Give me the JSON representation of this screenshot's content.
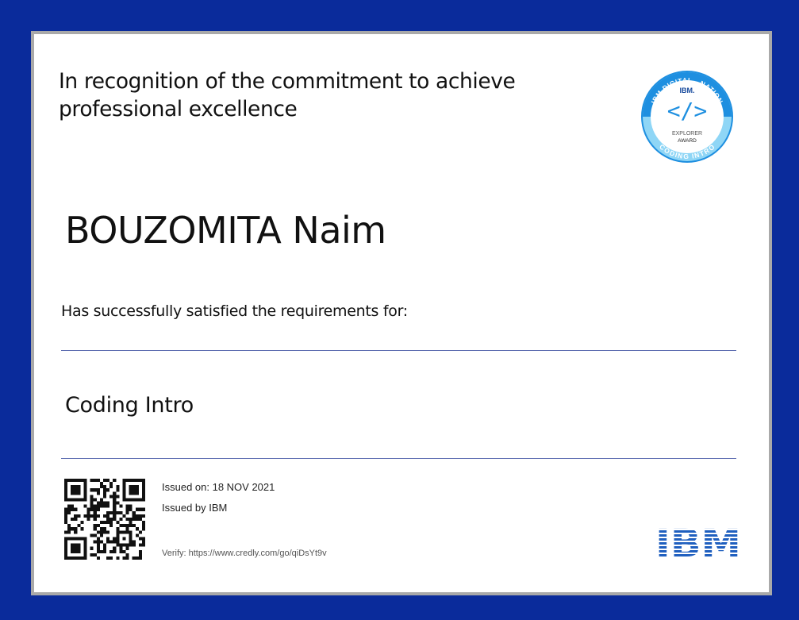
{
  "certificate": {
    "recognition_text": "In recognition of the commitment to achieve professional excellence",
    "recipient_name": "BOUZOMITA Naim",
    "requirements_text": "Has successfully satisfied the requirements for:",
    "course_title": "Coding Intro",
    "issued_on": "Issued on: 18 NOV 2021",
    "issued_by": "Issued by IBM",
    "verify_text": "Verify: https://www.credly.com/go/qiDsYt9v"
  },
  "badge": {
    "ring_top_text": "IBM DIGITAL - NATION",
    "ring_bottom_text": "CODING INTRO",
    "brand": "IBM.",
    "symbol": "</>",
    "line1": "EXPLORER",
    "line2": "AWARD",
    "colors": {
      "outer": "#1e8fe0",
      "inner_light": "#8fd6f6",
      "dark": "#174a9c"
    }
  },
  "logo": {
    "text": "IBM",
    "color": "#1f5fbf"
  },
  "colors": {
    "border": "#0a2b9b",
    "rule": "#5b6bb0"
  }
}
